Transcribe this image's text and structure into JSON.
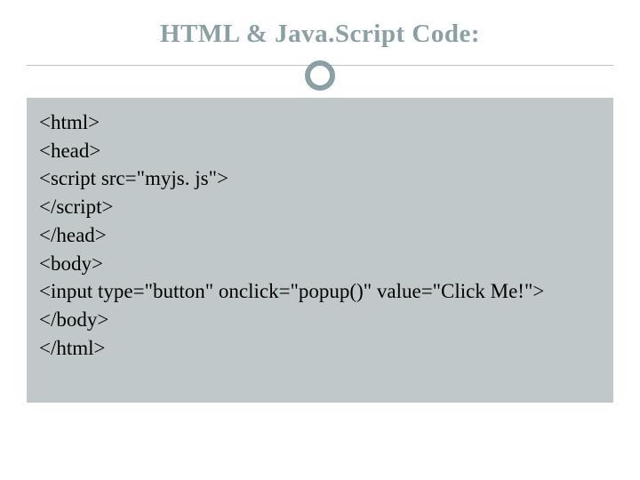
{
  "title": "HTML & Java.Script Code:",
  "code": {
    "lines": [
      "<html>",
      "<head>",
      "<script src=\"myjs. js\">",
      "</script>",
      "</head>",
      "<body>",
      "<input type=\"button\" onclick=\"popup()\" value=\"Click Me!\">",
      "</body>",
      "</html>"
    ]
  }
}
